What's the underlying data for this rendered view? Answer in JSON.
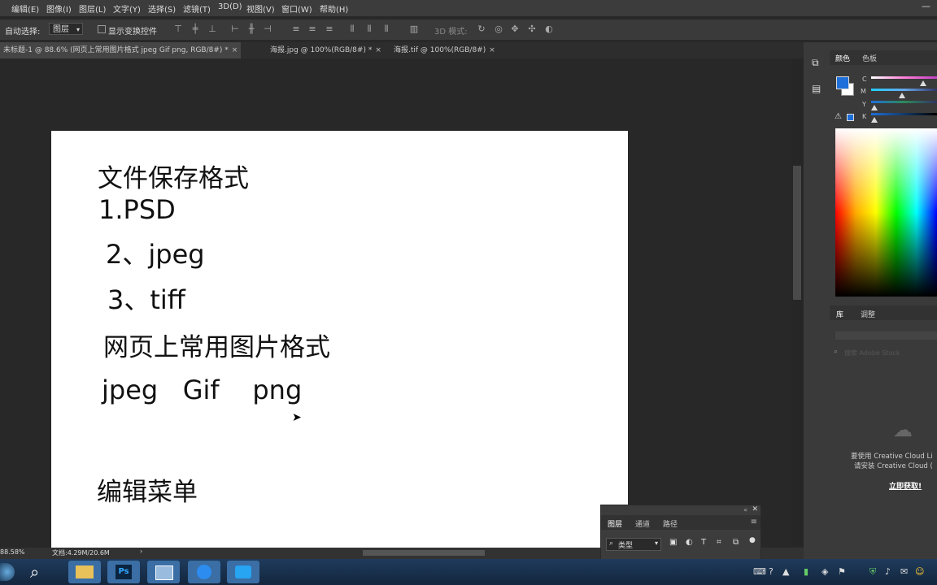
{
  "menubar": {
    "items": [
      "编辑(E)",
      "图像(I)",
      "图层(L)",
      "文字(Y)",
      "选择(S)",
      "滤镜(T)",
      "3D(D)",
      "视图(V)",
      "窗口(W)",
      "帮助(H)"
    ],
    "minimize": "—"
  },
  "options": {
    "auto_select_label": "自动选择:",
    "auto_select_value": "图层",
    "show_transform_label": "显示变换控件",
    "mode3d_label": "3D 模式:"
  },
  "tabs": [
    {
      "label": "未标题-1 @ 88.6% (网页上常用图片格式 jpeg   Gif    png, RGB/8#) *",
      "close": "×"
    },
    {
      "label": "海报.jpg @ 100%(RGB/8#) *",
      "close": "×"
    },
    {
      "label": "海报.tif @ 100%(RGB/8#)",
      "close": "×"
    }
  ],
  "canvas": {
    "lines": [
      "文件保存格式",
      "1.PSD",
      "2、jpeg",
      "3、tiff",
      "网页上常用图片格式",
      "jpeg   Gif    png",
      "编辑菜单"
    ]
  },
  "status": {
    "zoom": "88.58%",
    "doc": "文档:4.29M/20.6M",
    "arrow": "›"
  },
  "color_panel": {
    "tabs": [
      "颜色",
      "色板"
    ],
    "channels": [
      "C",
      "M",
      "Y",
      "K"
    ],
    "levels": [
      0.82,
      0.46,
      0.0,
      0.0
    ],
    "foreground_color": "#1e6fd9",
    "background_color": "#ffffff"
  },
  "library_panel": {
    "tabs": [
      "库",
      "调整"
    ],
    "search_placeholder": "搜索 Adobe Stock",
    "message_line1": "要使用 Creative Cloud Li",
    "message_line2": "请安装 Creative Cloud (",
    "link": "立即获取!"
  },
  "layers_panel": {
    "tabs": [
      "图层",
      "通道",
      "路径"
    ],
    "filter_label": "类型"
  },
  "taskbar": {
    "tray_glyphs": [
      "?",
      "▲",
      "⚑",
      "♪",
      "✉"
    ]
  }
}
